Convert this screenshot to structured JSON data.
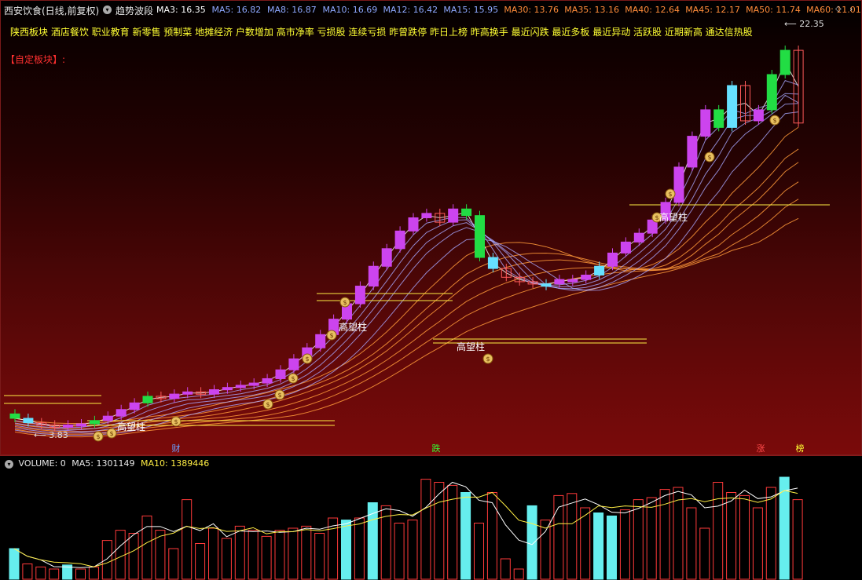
{
  "header": {
    "stock_title": "西安饮食(日线,前复权)",
    "indicator_name": "趋势波段",
    "ma_labels": [
      {
        "text": "MA3: 16.35",
        "color": "#ffffff"
      },
      {
        "text": "MA5: 16.82",
        "color": "#8ea8ff"
      },
      {
        "text": "MA8: 16.87",
        "color": "#8ea8ff"
      },
      {
        "text": "MA10: 16.69",
        "color": "#8ea8ff"
      },
      {
        "text": "MA12: 16.42",
        "color": "#8ea8ff"
      },
      {
        "text": "MA15: 15.95",
        "color": "#8ea8ff"
      },
      {
        "text": "MA30: 13.76",
        "color": "#ff8c3a"
      },
      {
        "text": "MA35: 13.16",
        "color": "#ff8c3a"
      },
      {
        "text": "MA40: 12.64",
        "color": "#ff8c3a"
      },
      {
        "text": "MA45: 12.17",
        "color": "#ff8c3a"
      },
      {
        "text": "MA50: 11.74",
        "color": "#ff8c3a"
      },
      {
        "text": "MA60: 11.01",
        "color": "#ff8c3a"
      }
    ]
  },
  "sectors": "陕西板块 酒店餐饮 职业教育 新零售 预制菜 地摊经济 户数增加 高市净率 亏损股 连续亏损 昨曾跌停 昨日上榜 昨高换手 最近闪跌 最近多板 最近异动 活跃股 近期新高 通达信热股",
  "custom_block_label": "【自定板块】:",
  "price_chart": {
    "high_label": "22.35",
    "low_label": "3.83",
    "signal_label": "高望柱",
    "markers": [
      {
        "text": "财",
        "color": "#6aa0ff"
      },
      {
        "text": "跌",
        "color": "#33ff33"
      },
      {
        "text": "涨",
        "color": "#ff4a4a"
      },
      {
        "text": "榜",
        "color": "#ffff33"
      }
    ]
  },
  "volume_header": {
    "volume_label": "VOLUME: 0",
    "ma5_label": "MA5: 1301149",
    "ma10_label": "MA10: 1389446"
  },
  "colors": {
    "up_candle": "#cc44ee",
    "down_candle": "#22dd44",
    "cyan_candle": "#66e0ff",
    "short_ma": "#a8a8ff",
    "long_ma": "#ff9a3a",
    "signal_line": "#ffee44",
    "volume_up": "#ff3a3a",
    "volume_down": "#66eeee"
  }
}
